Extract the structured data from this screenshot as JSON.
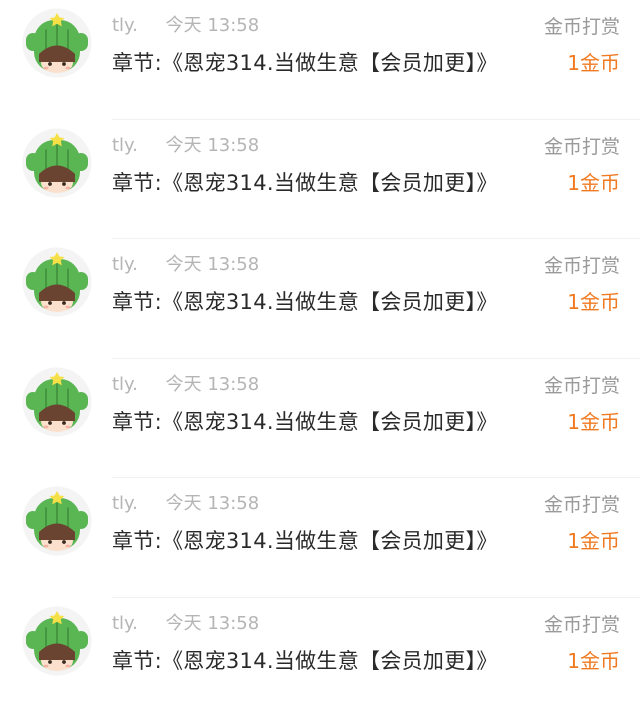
{
  "rewards": [
    {
      "user": "tly.",
      "time": "今天 13:58",
      "chapter": "章节:《恩宠314.当做生意【会员加更】》",
      "label": "金币打赏",
      "amount": "1金币"
    },
    {
      "user": "tly.",
      "time": "今天 13:58",
      "chapter": "章节:《恩宠314.当做生意【会员加更】》",
      "label": "金币打赏",
      "amount": "1金币"
    },
    {
      "user": "tly.",
      "time": "今天 13:58",
      "chapter": "章节:《恩宠314.当做生意【会员加更】》",
      "label": "金币打赏",
      "amount": "1金币"
    },
    {
      "user": "tly.",
      "time": "今天 13:58",
      "chapter": "章节:《恩宠314.当做生意【会员加更】》",
      "label": "金币打赏",
      "amount": "1金币"
    },
    {
      "user": "tly.",
      "time": "今天 13:58",
      "chapter": "章节:《恩宠314.当做生意【会员加更】》",
      "label": "金币打赏",
      "amount": "1金币"
    },
    {
      "user": "tly.",
      "time": "今天 13:58",
      "chapter": "章节:《恩宠314.当做生意【会员加更】》",
      "label": "金币打赏",
      "amount": "1金币"
    }
  ],
  "avatar_icon": "cactus-avatar-icon",
  "colors": {
    "amount": "#f07a22",
    "meta": "#b5b5b5",
    "label": "#9a9a9a",
    "text": "#2a2a2a",
    "cactus": "#5ab553",
    "flower": "#f6e048"
  }
}
